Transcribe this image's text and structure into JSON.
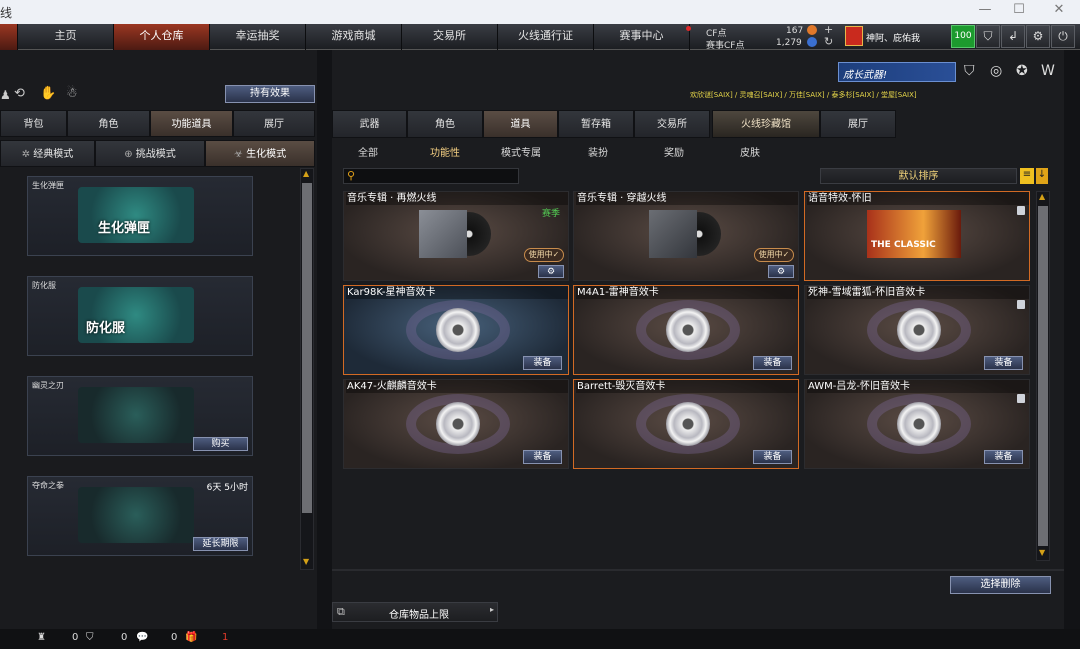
{
  "window": {
    "title": "线"
  },
  "topnav": {
    "tabs": [
      "主页",
      "个人仓库",
      "幸运抽奖",
      "游戏商城",
      "交易所",
      "火线通行证",
      "赛事中心"
    ],
    "cf_label": "CF点",
    "cf_value": "167",
    "event_cf_label": "赛事CF点",
    "event_cf_value": "1,279",
    "plus": "+",
    "refresh": "↻",
    "username": "神阿、庇佑我",
    "level": "100"
  },
  "left": {
    "effects_button": "持有效果",
    "tabs": [
      "背包",
      "角色",
      "功能道具",
      "展厅"
    ],
    "mode_tabs": [
      "经典模式",
      "挑战模式",
      "生化模式"
    ],
    "cards": [
      {
        "name": "生化弹匣",
        "art_label": "生化弹匣"
      },
      {
        "name": "防化服",
        "art_label": "防化服"
      },
      {
        "name": "幽灵之刃",
        "button": "购买"
      },
      {
        "name": "夺命之拳",
        "timer": "6天 5小时",
        "button": "延长期限"
      }
    ]
  },
  "right": {
    "banner": "成长武器!",
    "ticker": "欢欣谜[SAIX] / 灵魂召[SAIX] / 万佳[SAIX] / 泰多杉[SAIX] / 堂屋[SAIX]",
    "tabs": [
      "武器",
      "角色",
      "道具",
      "暂存箱",
      "交易所",
      "火线珍藏馆",
      "展厅"
    ],
    "subtabs": [
      "全部",
      "功能性",
      "模式专属",
      "装扮",
      "奖励",
      "皮肤"
    ],
    "search_placeholder": "",
    "sort_label": "默认排序",
    "cards": [
      {
        "title": "音乐专辑 · 再燃火线",
        "badge": "赛季",
        "inuse": "使用中✓"
      },
      {
        "title": "音乐专辑 · 穿越火线",
        "inuse": "使用中✓"
      },
      {
        "title": "语音特效-怀旧",
        "art_text": "THE CLASSIC"
      },
      {
        "title": "Kar98K-星神音效卡",
        "equip": "装备"
      },
      {
        "title": "M4A1-雷神音效卡",
        "equip": "装备"
      },
      {
        "title": "死神-雪域雷狐-怀旧音效卡",
        "equip": "装备"
      },
      {
        "title": "AK47-火麒麟音效卡",
        "equip": "装备"
      },
      {
        "title": "Barrett-毁灭音效卡",
        "equip": "装备"
      },
      {
        "title": "AWM-吕龙-怀旧音效卡",
        "equip": "装备"
      }
    ],
    "delete_button": "选择删除",
    "storage_limit": "仓库物品上限"
  },
  "bottombar": {
    "counts": [
      "0",
      "0",
      "0",
      "1"
    ]
  }
}
